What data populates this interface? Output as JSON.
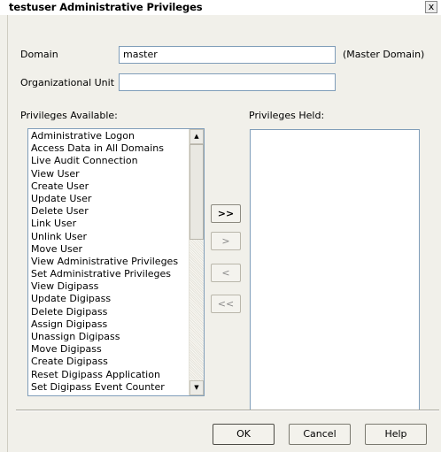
{
  "window": {
    "title": "testuser Administrative Privileges",
    "close_glyph": "x"
  },
  "form": {
    "domain_label": "Domain",
    "domain_value": "master",
    "domain_note": "(Master Domain)",
    "ou_label": "Organizational Unit",
    "ou_value": ""
  },
  "available": {
    "label": "Privileges Available:",
    "items": [
      "Administrative Logon",
      "Access Data in All Domains",
      "Live Audit Connection",
      "View User",
      "Create User",
      "Update User",
      "Delete User",
      "Link User",
      "Unlink User",
      "Move User",
      "View Administrative Privileges",
      "Set Administrative Privileges",
      "View Digipass",
      "Update Digipass",
      "Delete Digipass",
      "Assign Digipass",
      "Unassign Digipass",
      "Move Digipass",
      "Create Digipass",
      "Reset Digipass Application",
      "Set Digipass Event Counter"
    ]
  },
  "held": {
    "label": "Privileges Held:",
    "items": []
  },
  "transfer": {
    "add_all": ">>",
    "add": ">",
    "remove": "<",
    "remove_all": "<<"
  },
  "buttons": {
    "ok": "OK",
    "cancel": "Cancel",
    "help": "Help"
  }
}
